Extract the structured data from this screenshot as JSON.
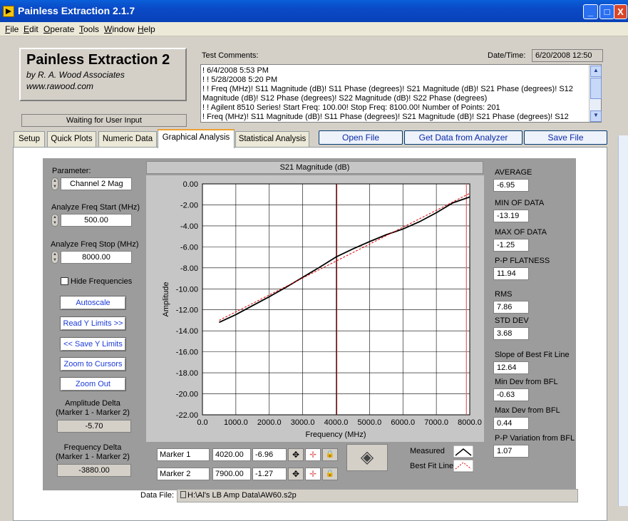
{
  "window": {
    "title": "Painless Extraction 2.1.7",
    "buttons": {
      "minimize": "_",
      "maximize": "□",
      "close": "X"
    }
  },
  "menu": [
    "File",
    "Edit",
    "Operate",
    "Tools",
    "Window",
    "Help"
  ],
  "logo": {
    "title": "Painless Extraction 2",
    "by": "by R. A. Wood Associates",
    "url": "www.rawood.com"
  },
  "status": "Waiting for User Input",
  "comments": {
    "label": "Test Comments:",
    "lines": [
      "! 6/4/2008 5:53 PM",
      "! ! 5/28/2008 5:20 PM",
      "! ! Freq (MHz)! S11 Magnitude (dB)! S11 Phase (degrees)! S21 Magnitude (dB)! S21 Phase (degrees)! S12",
      "Magnitude (dB)! S12 Phase (degrees)! S22 Magnitude (dB)! S22 Phase (degrees)",
      "! ! Agilent 8510 Series! Start Freq: 100.00! Stop Freq: 8100.00! Number of Points: 201",
      "! Freq (MHz)! S11 Magnitude (dB)! S11 Phase (degrees)! S21 Magnitude (dB)! S21 Phase (degrees)! S12"
    ]
  },
  "datetime": {
    "label": "Date/Time:",
    "value": "6/20/2008  12:50"
  },
  "tabs": [
    "Setup",
    "Quick Plots",
    "Numeric Data",
    "Graphical Analysis",
    "Statistical Analysis"
  ],
  "active_tab": "Graphical Analysis",
  "top_buttons": {
    "open": "Open File",
    "get": "Get Data from Analyzer",
    "save": "Save File"
  },
  "left_controls": {
    "parameter_label": "Parameter:",
    "parameter_value": "Channel 2 Mag",
    "start_label": "Analyze Freq Start (MHz)",
    "start_value": "500.00",
    "stop_label": "Analyze Freq Stop (MHz)",
    "stop_value": "8000.00",
    "hide_freq_label": "Hide Frequencies",
    "hide_freq_checked": false,
    "buttons": [
      "Autoscale",
      "Read Y Limits >>",
      "<< Save Y Limits",
      "Zoom to Cursors",
      "Zoom Out"
    ],
    "amp_delta_label1": "Amplitude Delta",
    "amp_delta_label2": "(Marker 1 - Marker 2)",
    "amp_delta_value": "-5.70",
    "freq_delta_label1": "Frequency Delta",
    "freq_delta_label2": "(Marker 1 - Marker 2)",
    "freq_delta_value": "-3880.00"
  },
  "chart_data": {
    "type": "line",
    "title": "S21 Magnitude (dB)",
    "xlabel": "Frequency (MHz)",
    "ylabel": "Amplitude",
    "xlim": [
      0,
      8000
    ],
    "ylim": [
      -22,
      0
    ],
    "x_ticks": [
      "0.0",
      "1000.0",
      "2000.0",
      "3000.0",
      "4000.0",
      "5000.0",
      "6000.0",
      "7000.0",
      "8000.0"
    ],
    "y_ticks": [
      "0.00",
      "-2.00",
      "-4.00",
      "-6.00",
      "-8.00",
      "-10.00",
      "-12.00",
      "-14.00",
      "-16.00",
      "-18.00",
      "-20.00",
      "-22.00"
    ],
    "grid": true,
    "series": [
      {
        "name": "Measured",
        "color": "#000000",
        "x": [
          500,
          1000,
          1500,
          2000,
          2500,
          3000,
          3500,
          4000,
          4500,
          5000,
          5500,
          6000,
          6500,
          7000,
          7500,
          8000
        ],
        "y": [
          -13.19,
          -12.45,
          -11.6,
          -10.75,
          -9.85,
          -8.9,
          -7.95,
          -6.96,
          -6.2,
          -5.5,
          -4.85,
          -4.3,
          -3.6,
          -2.75,
          -1.8,
          -1.25
        ]
      },
      {
        "name": "Best Fit Line",
        "color": "#e00000",
        "dashed": true,
        "x": [
          500,
          8000
        ],
        "y": [
          -13.0,
          -0.9
        ]
      }
    ],
    "markers": [
      {
        "name": "Marker 1",
        "x": 4020,
        "color": "#8b1a1a"
      },
      {
        "name": "Marker 2",
        "x": 7900,
        "color": "#e06060"
      }
    ]
  },
  "markers_table": [
    {
      "label": "Marker 1",
      "freq": "4020.00",
      "amp": "-6.96"
    },
    {
      "label": "Marker 2",
      "freq": "7900.00",
      "amp": "-1.27"
    }
  ],
  "legend": {
    "measured": "Measured",
    "bestfit": "Best Fit Line"
  },
  "stats": [
    {
      "label": "AVERAGE",
      "value": "-6.95"
    },
    {
      "label": "MIN OF DATA",
      "value": "-13.19"
    },
    {
      "label": "MAX OF DATA",
      "value": "-1.25"
    },
    {
      "label": "P-P FLATNESS",
      "value": "11.94"
    },
    {
      "label": "RMS",
      "value": "7.86"
    },
    {
      "label": "STD DEV",
      "value": "3.68"
    },
    {
      "label": "Slope of Best Fit Line",
      "value": "12.64"
    },
    {
      "label": "Min Dev from BFL",
      "value": "-0.63"
    },
    {
      "label": "Max Dev from BFL",
      "value": "0.44"
    },
    {
      "label": "P-P Variation from BFL",
      "value": "1.07"
    }
  ],
  "datafile": {
    "label": "Data File:",
    "value": "H:\\Al's LB Amp Data\\AW60.s2p"
  }
}
